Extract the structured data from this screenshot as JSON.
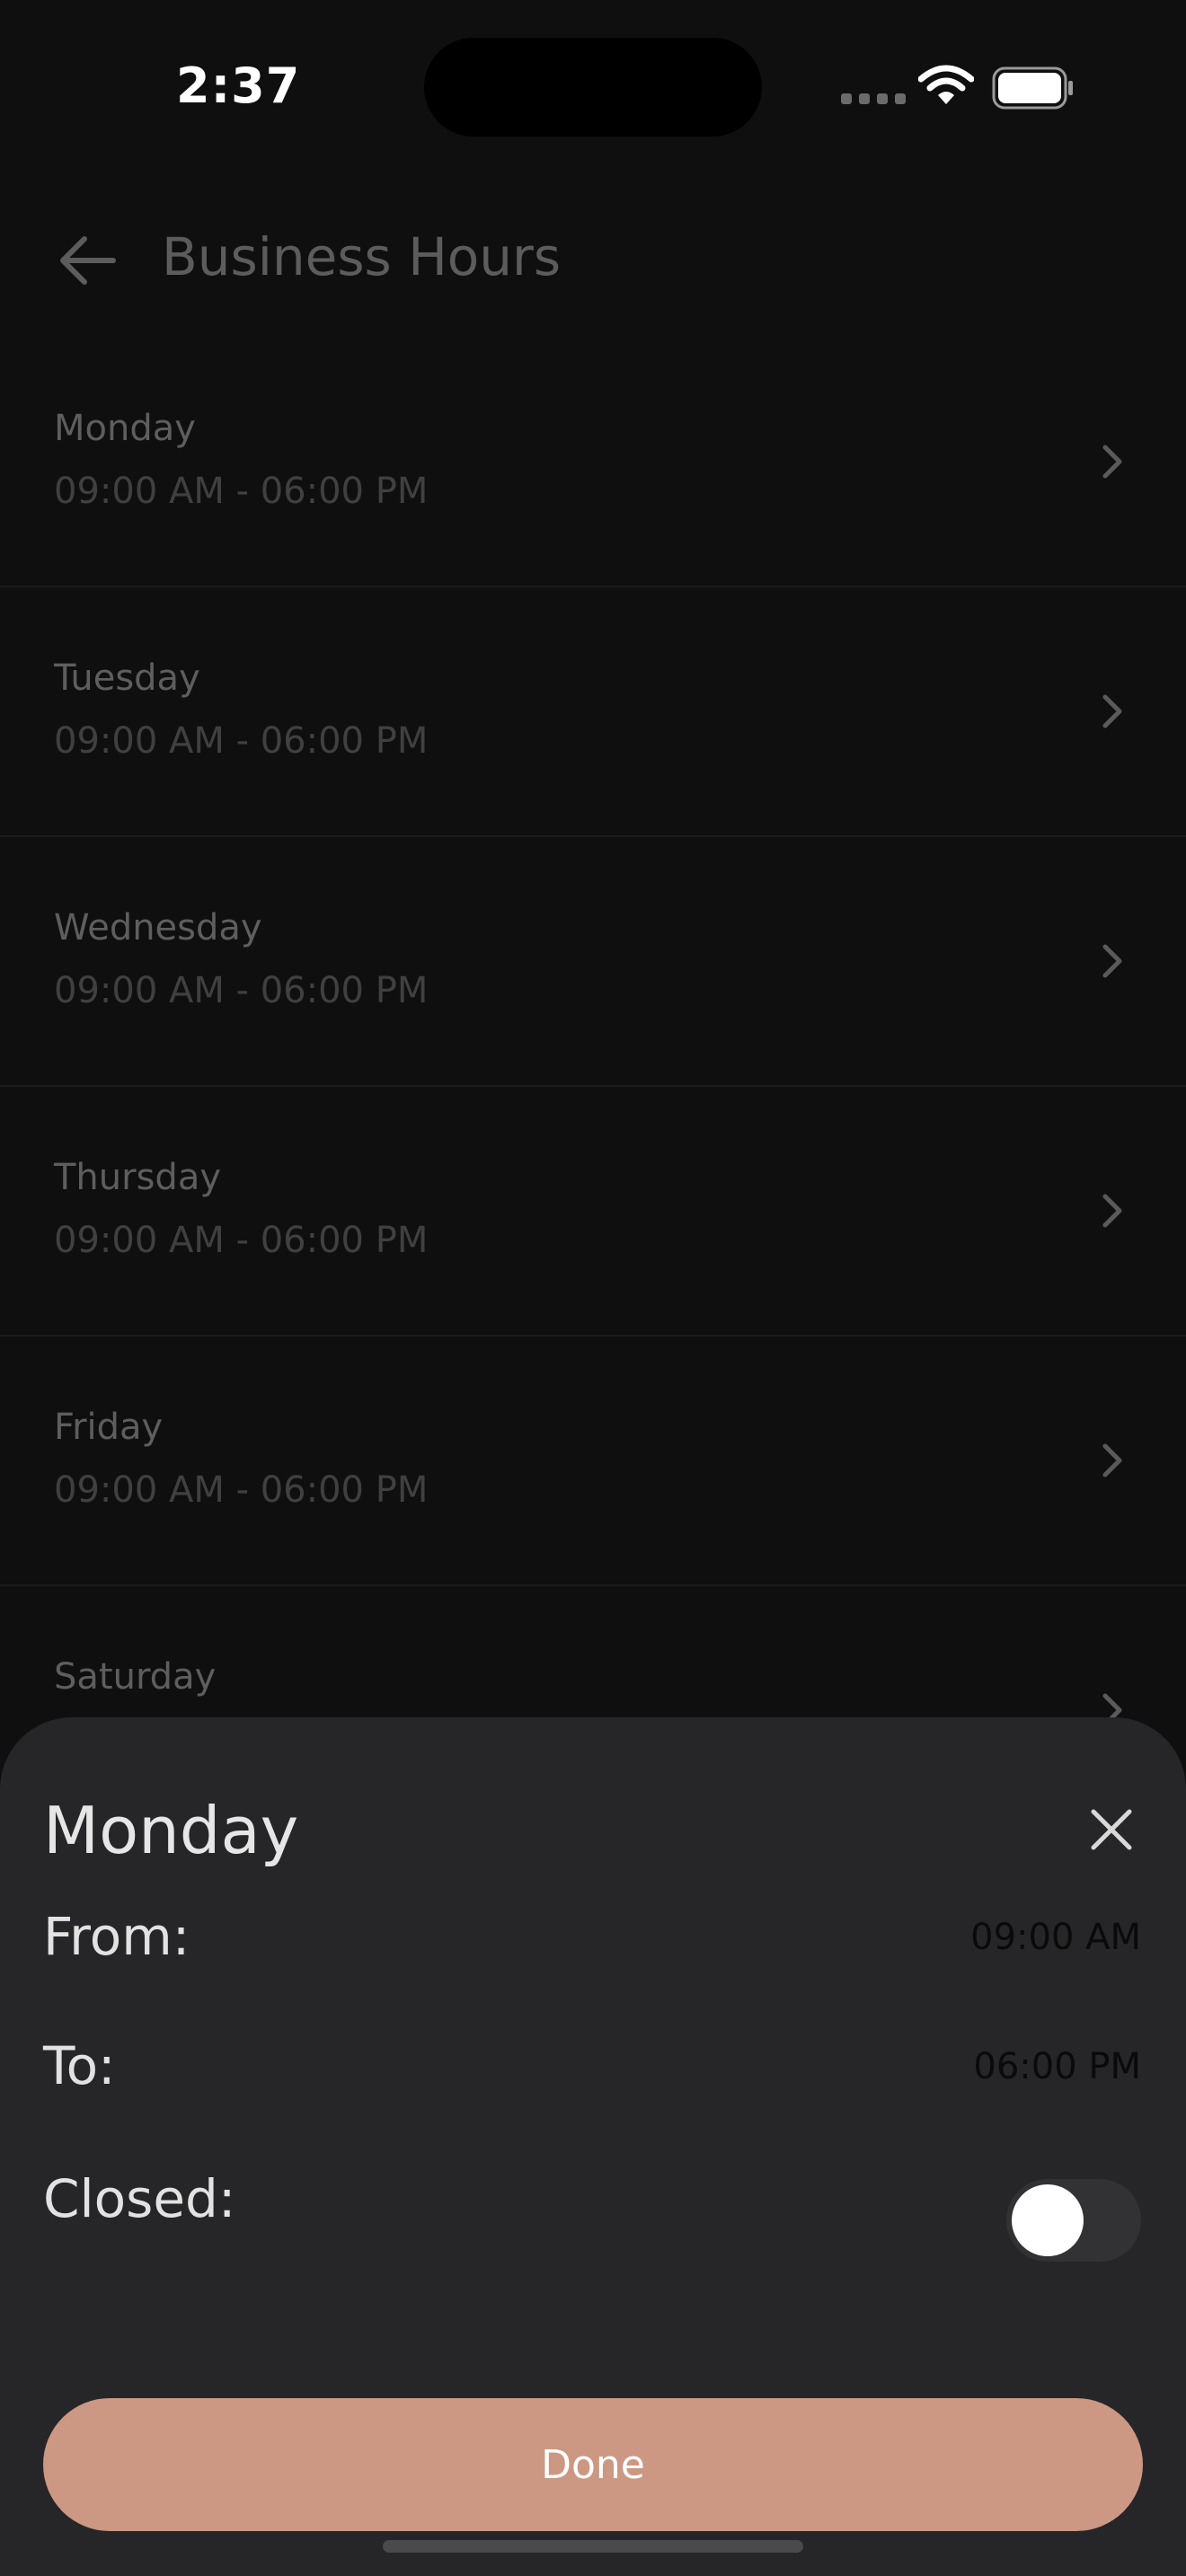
{
  "status_bar": {
    "time": "2:37"
  },
  "header": {
    "title": "Business Hours"
  },
  "days": [
    {
      "name": "Monday",
      "hours": "09:00 AM - 06:00 PM"
    },
    {
      "name": "Tuesday",
      "hours": "09:00 AM - 06:00 PM"
    },
    {
      "name": "Wednesday",
      "hours": "09:00 AM - 06:00 PM"
    },
    {
      "name": "Thursday",
      "hours": "09:00 AM - 06:00 PM"
    },
    {
      "name": "Friday",
      "hours": "09:00 AM - 06:00 PM"
    },
    {
      "name": "Saturday",
      "hours": ""
    }
  ],
  "sheet": {
    "title": "Monday",
    "from_label": "From:",
    "from_value": "09:00 AM",
    "to_label": "To:",
    "to_value": "06:00 PM",
    "closed_label": "Closed:",
    "closed_on": false,
    "done_label": "Done"
  },
  "colors": {
    "accent": "#cc9883",
    "sheet_bg": "#262628",
    "page_bg": "#0f0f10"
  },
  "icons": [
    "back-arrow-icon",
    "chevron-right-icon",
    "close-icon",
    "wifi-icon",
    "battery-icon",
    "signal-icon"
  ]
}
